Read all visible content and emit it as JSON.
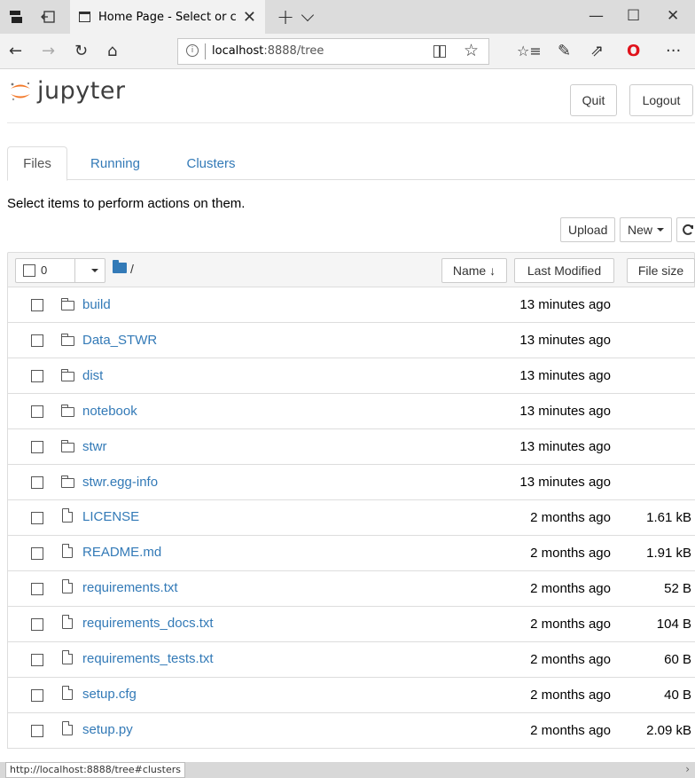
{
  "browser": {
    "tab_title": "Home Page - Select or c",
    "tab_close": "✕",
    "new_tab": "+",
    "win_min": "—",
    "win_max": "☐",
    "win_close": "✕",
    "url_host": "localhost",
    "url_rest": ":8888/tree",
    "more": "···",
    "icons": [
      "back-icon",
      "forward-icon",
      "refresh-icon",
      "home-icon",
      "info-icon",
      "reading-view-icon",
      "favorite-star-icon",
      "favorites-hub-icon",
      "pen-icon",
      "share-icon",
      "opera-icon",
      "more-icon"
    ]
  },
  "header": {
    "logo_text": "jupyter",
    "quit_label": "Quit",
    "logout_label": "Logout"
  },
  "tabs": [
    {
      "label": "Files",
      "active": true
    },
    {
      "label": "Running",
      "active": false
    },
    {
      "label": "Clusters",
      "active": false
    }
  ],
  "info_text": "Select items to perform actions on them.",
  "toolbar": {
    "upload_label": "Upload",
    "new_label": "New",
    "refresh_icon": "refresh-icon"
  },
  "list_header": {
    "selected_count": "0",
    "breadcrumb": "/",
    "sort_name": "Name ↓",
    "sort_modified": "Last Modified",
    "sort_size": "File size"
  },
  "files": [
    {
      "name": "build",
      "type": "folder",
      "modified": "13 minutes ago",
      "size": ""
    },
    {
      "name": "Data_STWR",
      "type": "folder",
      "modified": "13 minutes ago",
      "size": ""
    },
    {
      "name": "dist",
      "type": "folder",
      "modified": "13 minutes ago",
      "size": ""
    },
    {
      "name": "notebook",
      "type": "folder",
      "modified": "13 minutes ago",
      "size": ""
    },
    {
      "name": "stwr",
      "type": "folder",
      "modified": "13 minutes ago",
      "size": ""
    },
    {
      "name": "stwr.egg-info",
      "type": "folder",
      "modified": "13 minutes ago",
      "size": ""
    },
    {
      "name": "LICENSE",
      "type": "file",
      "modified": "2 months ago",
      "size": "1.61 kB"
    },
    {
      "name": "README.md",
      "type": "file",
      "modified": "2 months ago",
      "size": "1.91 kB"
    },
    {
      "name": "requirements.txt",
      "type": "file",
      "modified": "2 months ago",
      "size": "52 B"
    },
    {
      "name": "requirements_docs.txt",
      "type": "file",
      "modified": "2 months ago",
      "size": "104 B"
    },
    {
      "name": "requirements_tests.txt",
      "type": "file",
      "modified": "2 months ago",
      "size": "60 B"
    },
    {
      "name": "setup.cfg",
      "type": "file",
      "modified": "2 months ago",
      "size": "40 B"
    },
    {
      "name": "setup.py",
      "type": "file",
      "modified": "2 months ago",
      "size": "2.09 kB"
    }
  ],
  "status_bar": {
    "url": "http://localhost:8888/tree#clusters",
    "arrow": "›"
  }
}
